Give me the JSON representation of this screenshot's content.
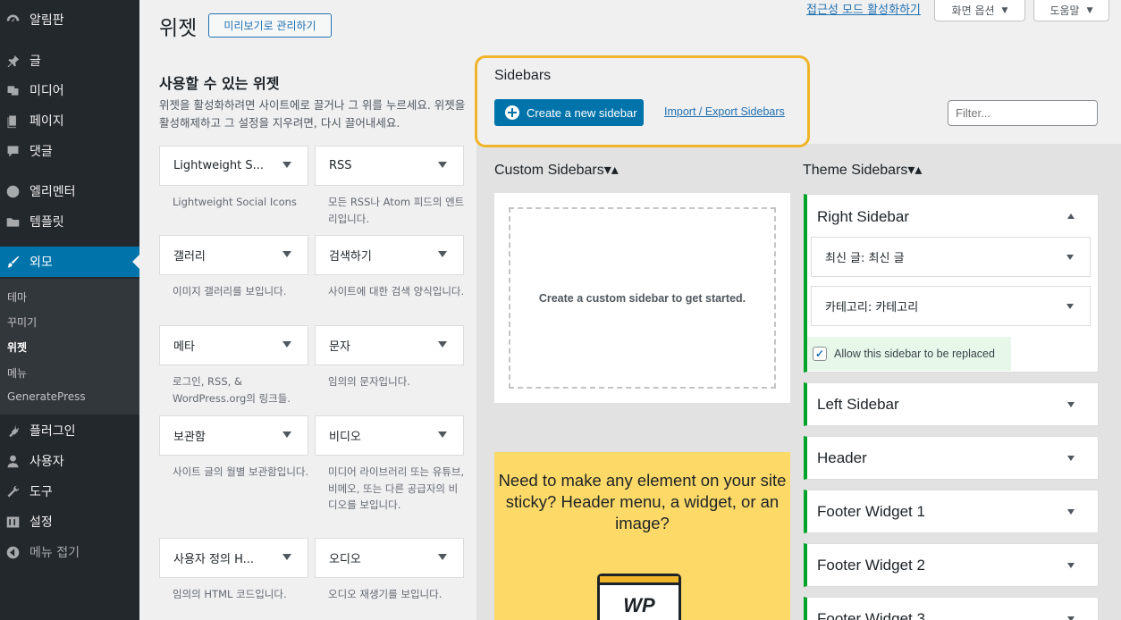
{
  "menu": {
    "items": [
      {
        "label": "알림판",
        "icon": "dashboard-icon"
      },
      {
        "label": "글",
        "icon": "pin-icon"
      },
      {
        "label": "미디어",
        "icon": "media-icon"
      },
      {
        "label": "페이지",
        "icon": "page-icon"
      },
      {
        "label": "댓글",
        "icon": "comment-icon"
      },
      {
        "label": "엘리멘터",
        "icon": "elementor-icon"
      },
      {
        "label": "템플릿",
        "icon": "folder-icon"
      },
      {
        "label": "외모",
        "icon": "brush-icon"
      },
      {
        "label": "플러그인",
        "icon": "plug-icon"
      },
      {
        "label": "사용자",
        "icon": "user-icon"
      },
      {
        "label": "도구",
        "icon": "wrench-icon"
      },
      {
        "label": "설정",
        "icon": "settings-icon"
      },
      {
        "label": "메뉴 접기",
        "icon": "collapse-icon"
      }
    ],
    "submenu": [
      "테마",
      "꾸미기",
      "위젯",
      "메뉴",
      "GeneratePress"
    ]
  },
  "header": {
    "title": "위젯",
    "preview_button": "미리보기로 관리하기",
    "accessibility_link": "접근성 모드 활성화하기",
    "screen_options": "화면 옵션",
    "help": "도움말"
  },
  "available": {
    "title": "사용할 수 있는 위젯",
    "description": "위젯을 활성화하려면 사이트에로 끌거나 그 위를 누르세요. 위젯을 활성해제하고 그 설정을 지우려면, 다시 끌어내세요.",
    "widgets": [
      {
        "title": "Lightweight S...",
        "desc": "Lightweight Social Icons"
      },
      {
        "title": "RSS",
        "desc": "모든 RSS나 Atom 피드의 엔트리입니다."
      },
      {
        "title": "갤러리",
        "desc": "이미지 갤러리를 보입니다."
      },
      {
        "title": "검색하기",
        "desc": "사이트에 대한 검색 양식입니다."
      },
      {
        "title": "메타",
        "desc": "로그인, RSS, & WordPress.org의 링크들."
      },
      {
        "title": "문자",
        "desc": "임의의 문자입니다."
      },
      {
        "title": "보관함",
        "desc": "사이트 글의 월별 보관함입니다."
      },
      {
        "title": "비디오",
        "desc": "미디어 라이브러리 또는 유튜브, 비메오, 또는 다른 공급자의 비디오를 보입니다."
      },
      {
        "title": "사용자 정의 H...",
        "desc": "임의의 HTML 코드입니다."
      },
      {
        "title": "오디오",
        "desc": "오디오 재생기를 보입니다."
      }
    ]
  },
  "sidebars": {
    "title": "Sidebars",
    "create_button": "Create a new sidebar",
    "import_link": "Import / Export Sidebars",
    "filter_placeholder": "Filter...",
    "custom_title": "Custom Sidebars▾▴",
    "theme_title": "Theme Sidebars▾▴",
    "empty_text": "Create a custom sidebar to get started.",
    "promo_text": "Need to make any element on your site sticky? Header menu, a widget, or an image?",
    "promo_badge": "WP",
    "theme": [
      {
        "title": "Right Sidebar",
        "expanded": true
      },
      {
        "title": "Left Sidebar"
      },
      {
        "title": "Header"
      },
      {
        "title": "Footer Widget 1"
      },
      {
        "title": "Footer Widget 2"
      },
      {
        "title": "Footer Widget 3"
      }
    ],
    "right_widgets": [
      "최신 글: 최신 글",
      "카테고리: 카테고리"
    ],
    "allow_replace": "Allow this sidebar to be replaced",
    "allow_checked": true
  },
  "colors": {
    "menu_bg": "#23282d",
    "accent": "#0073aa",
    "highlight": "#f0b429",
    "promo": "#fdd967",
    "active_border": "#00a32a"
  }
}
